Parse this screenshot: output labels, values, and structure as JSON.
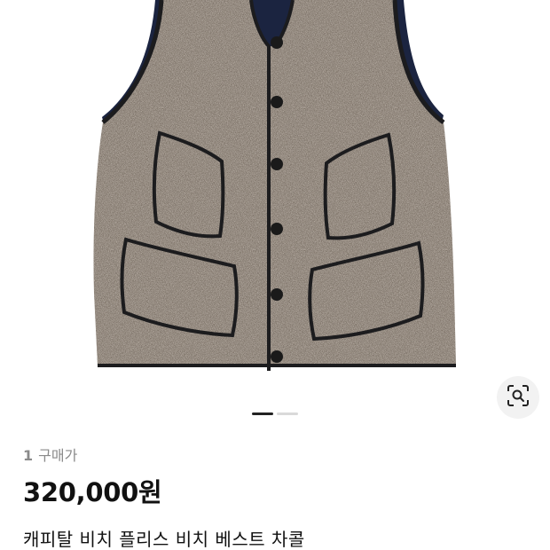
{
  "product": {
    "image_alt": "product-photo-vest",
    "gallery": {
      "total": 2,
      "active_index": 0
    }
  },
  "buyer_info": {
    "count": "1",
    "label": "구매가"
  },
  "price": "320,000원",
  "title": "캐피탈 비치 플리스 비치 베스트 차콜",
  "subtitle": "",
  "colors": {
    "fleece": "#7b7166",
    "piping": "#1c1c1e",
    "lining": "#1b2440",
    "pager_active": "#222222",
    "pager_inactive": "#d9d9d9",
    "lens_bg": "#f2f2f2"
  },
  "icons": {
    "lens": "image-search-icon"
  }
}
